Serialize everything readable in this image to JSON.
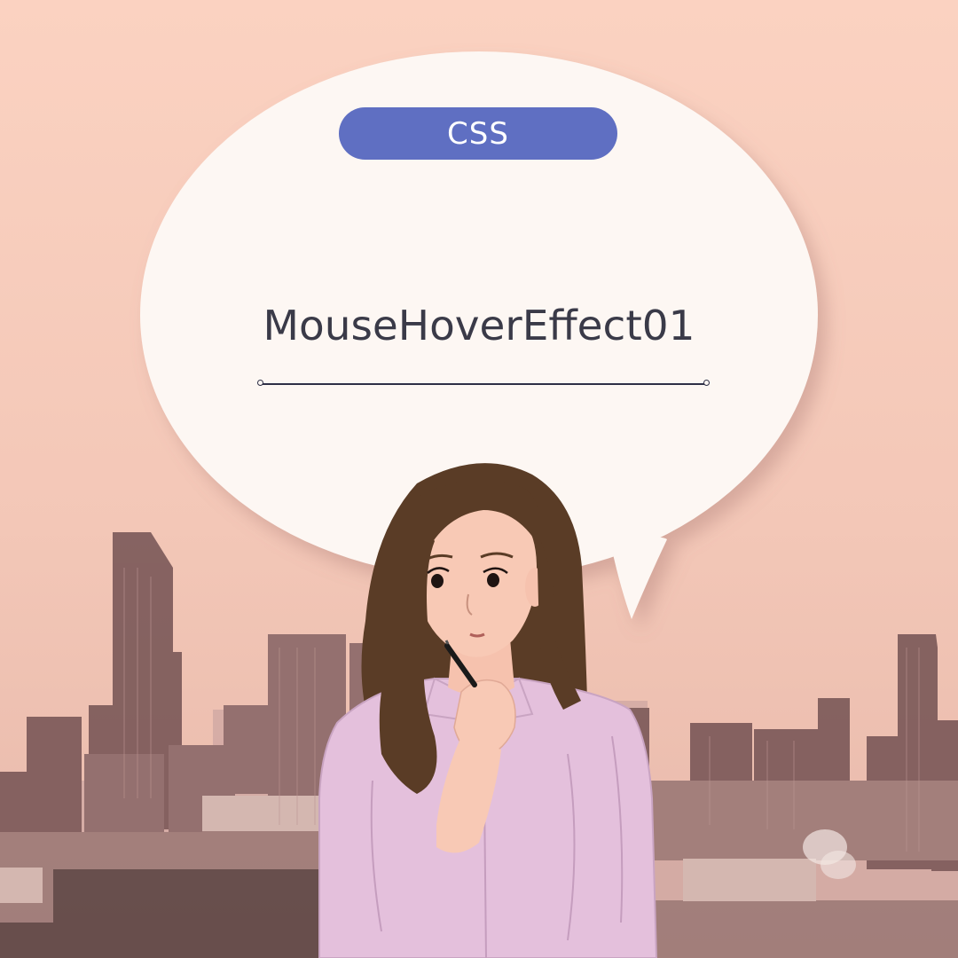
{
  "badge": {
    "label": "CSS"
  },
  "title": "MouseHoverEffect01",
  "colors": {
    "background": "#f6d2c2",
    "bubble": "#fdf7f3",
    "badge": "#5f6fc2",
    "title_text": "#3a3a48",
    "divider": "#2e2f46",
    "shirt": "#e4c0dc",
    "hair": "#5a3c26",
    "skin": "#f6c2ae"
  },
  "illustration": {
    "bubble_icon": "speech-bubble-icon",
    "character_icon": "thinking-woman-icon",
    "pen_icon": "pen-icon",
    "skyline_icon": "city-skyline-icon"
  }
}
